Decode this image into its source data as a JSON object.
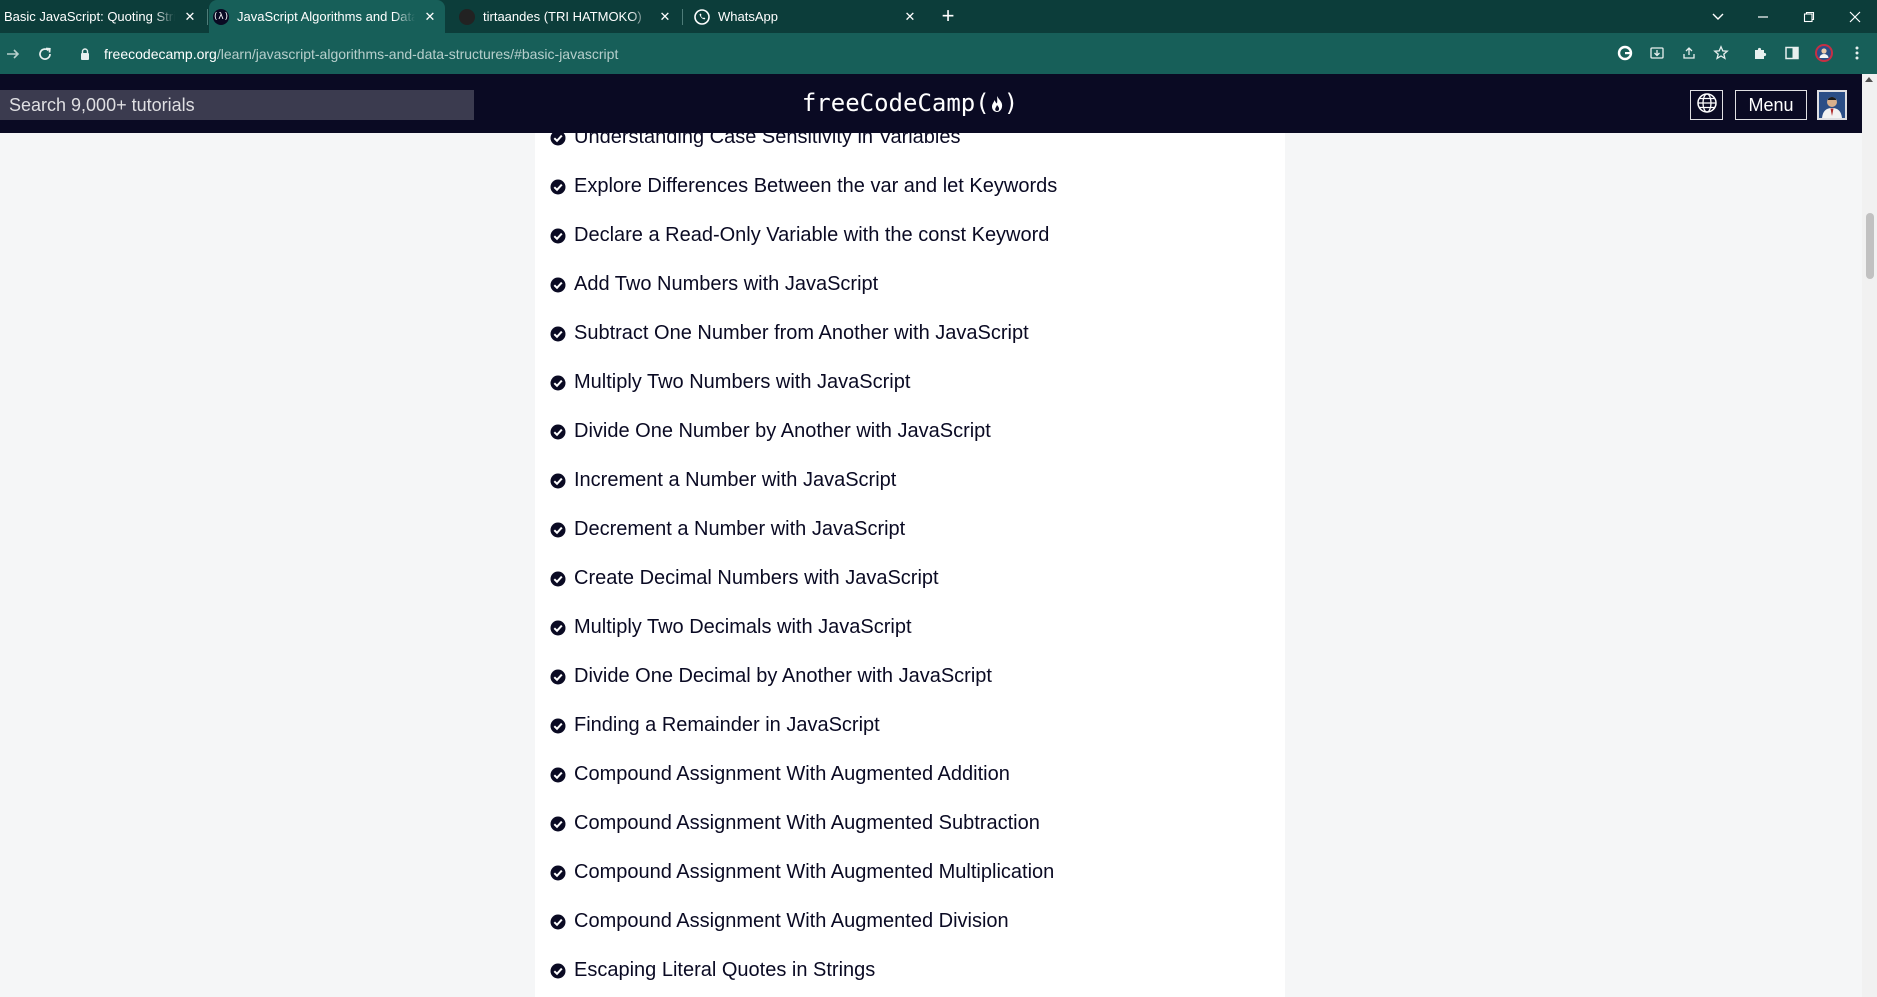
{
  "browser": {
    "tabs": [
      {
        "title": "Basic JavaScript: Quoting Strings",
        "favicon": "freecodecamp-icon",
        "active": false
      },
      {
        "title": "JavaScript Algorithms and Data Structures",
        "favicon": "freecodecamp-icon",
        "active": true
      },
      {
        "title": "tirtaandes (TRI HATMOKO)",
        "favicon": "github-icon",
        "active": false
      },
      {
        "title": "WhatsApp",
        "favicon": "whatsapp-icon",
        "active": false
      }
    ],
    "url": {
      "host": "freecodecamp.org",
      "path": "/learn/javascript-algorithms-and-data-structures/#basic-javascript"
    }
  },
  "nav": {
    "search_placeholder": "Search 9,000+ tutorials",
    "logo_text": "freeCodeCamp(",
    "logo_suffix": ")",
    "menu_label": "Menu"
  },
  "challenges": [
    "Understanding Case Sensitivity in Variables",
    "Explore Differences Between the var and let Keywords",
    "Declare a Read-Only Variable with the const Keyword",
    "Add Two Numbers with JavaScript",
    "Subtract One Number from Another with JavaScript",
    "Multiply Two Numbers with JavaScript",
    "Divide One Number by Another with JavaScript",
    "Increment a Number with JavaScript",
    "Decrement a Number with JavaScript",
    "Create Decimal Numbers with JavaScript",
    "Multiply Two Decimals with JavaScript",
    "Divide One Decimal by Another with JavaScript",
    "Finding a Remainder in JavaScript",
    "Compound Assignment With Augmented Addition",
    "Compound Assignment With Augmented Subtraction",
    "Compound Assignment With Augmented Multiplication",
    "Compound Assignment With Augmented Division",
    "Escaping Literal Quotes in Strings"
  ],
  "colors": {
    "tab_strip": "#0c3d3a",
    "toolbar": "#175f59",
    "fcc_nav": "#0a0a23",
    "check": "#0a0a23"
  }
}
